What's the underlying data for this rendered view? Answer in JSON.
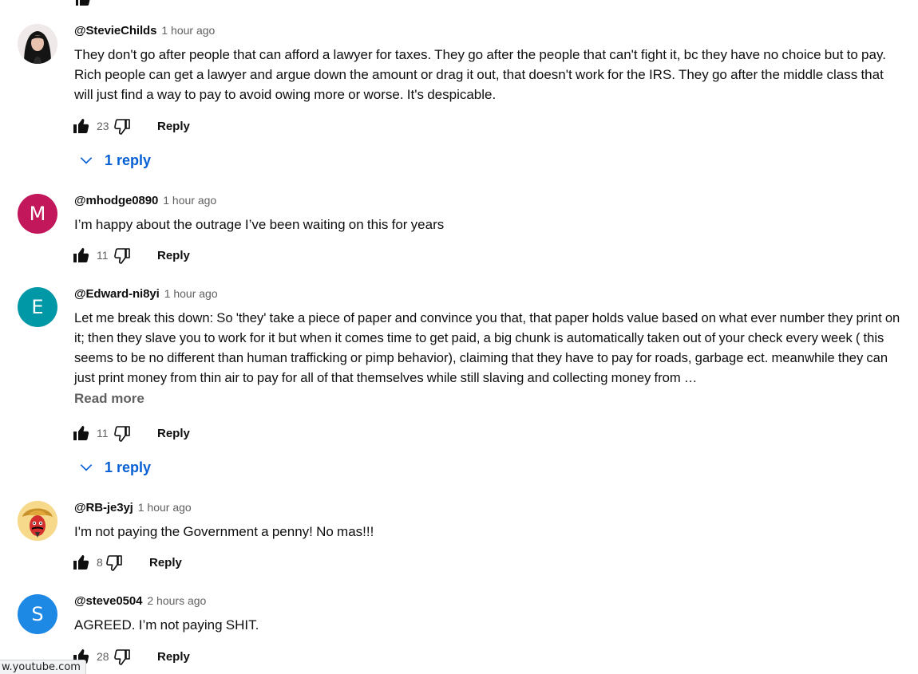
{
  "comments": [
    {
      "handle": "@StevieChilds",
      "time": "1 hour ago",
      "text": "They don't go after people that can afford a lawyer for taxes. They go after the people that can't fight it, bc they have no choice but to pay. Rich people can get a lawyer and argue down the amount or drag it out, that doesn't work for the IRS. They go after the middle class that will just find a way to pay to avoid owing more or worse. It's despicable.",
      "likes": "23",
      "reply_label": "Reply",
      "replies_label": "1 reply",
      "avatar_color": "#1a1a1a"
    },
    {
      "handle": "@mhodge0890",
      "time": "1 hour ago",
      "text": "I’m happy about the outrage I’ve been waiting on this for years",
      "likes": "11",
      "reply_label": "Reply",
      "avatar_letter": "M",
      "avatar_color": "#c2185b"
    },
    {
      "handle": "@Edward-ni8yi",
      "time": "1 hour ago",
      "text": "Let me break this down: So 'they' take a piece of paper and convince you that, that paper holds value based on what ever number they print on it; then they slave you to work for it but when it comes time to get paid, a big chunk is automatically taken out of your check every week ( this seems to be no different than human trafficking or pimp behavior), claiming that they have to pay for roads, garbage ect. meanwhile they can just print money from thin air to pay for all of that themselves while still slaving and collecting money from …",
      "read_more": "Read more",
      "likes": "11",
      "reply_label": "Reply",
      "replies_label": "1 reply",
      "avatar_letter": "E",
      "avatar_color": "#0097a7"
    },
    {
      "handle": "@RB-je3yj",
      "time": "1 hour ago",
      "text": "I'm not paying the Government a penny! No mas!!!",
      "likes": "8",
      "reply_label": "Reply",
      "avatar_color": "#f6d98a"
    },
    {
      "handle": "@steve0504",
      "time": "2 hours ago",
      "text": "AGREED. I’m not paying SHIT.",
      "likes": "28",
      "reply_label": "Reply",
      "avatar_letter": "S",
      "avatar_color": "#1e88e5"
    }
  ],
  "colors": {
    "link_blue": "#065fd4",
    "secondary_text": "#606060"
  },
  "status_bar": {
    "url": "w.youtube.com"
  }
}
